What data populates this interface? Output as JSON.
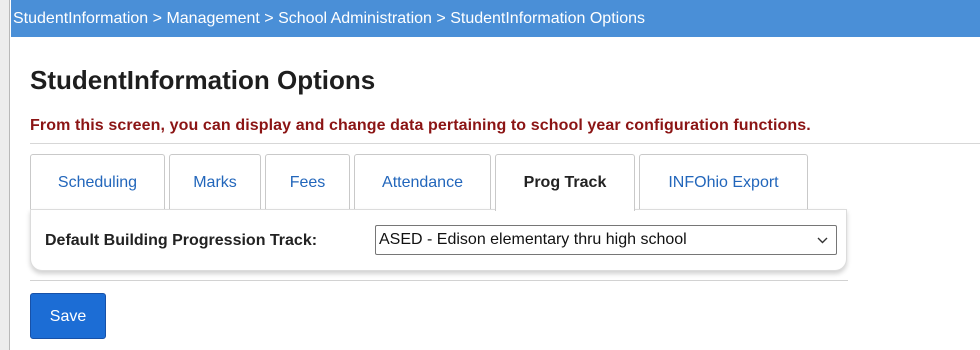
{
  "breadcrumb": {
    "items": [
      "StudentInformation",
      "Management",
      "School Administration",
      "StudentInformation Options"
    ],
    "separator": ">"
  },
  "page": {
    "title": "StudentInformation Options",
    "description": "From this screen, you can display and change data pertaining to school year configuration functions."
  },
  "tabs": [
    {
      "label": "Scheduling",
      "active": false
    },
    {
      "label": "Marks",
      "active": false
    },
    {
      "label": "Fees",
      "active": false
    },
    {
      "label": "Attendance",
      "active": false
    },
    {
      "label": "Prog Track",
      "active": true
    },
    {
      "label": "INFOhio Export",
      "active": false
    }
  ],
  "form": {
    "progression_track_label": "Default Building Progression Track:",
    "progression_track_value": "ASED - Edison elementary thru high school",
    "dropdown_icon": "chevron-down-icon"
  },
  "actions": {
    "save_label": "Save"
  },
  "colors": {
    "breadcrumb_bg": "#4a8fd7",
    "description_text": "#8b1414",
    "tab_link": "#2266bb",
    "save_bg": "#1c6dd5"
  }
}
